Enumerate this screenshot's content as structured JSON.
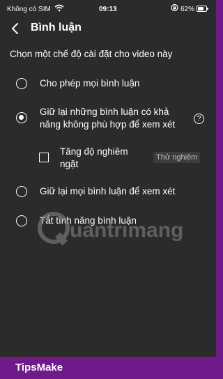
{
  "status_bar": {
    "carrier": "Không có SIM",
    "time": "09:13",
    "battery": "62%",
    "battery_level": 0.62
  },
  "header": {
    "title": "Bình luận"
  },
  "prompt": "Chọn một chế độ cài đặt cho video này",
  "options": [
    {
      "label": "Cho phép mọi bình luận",
      "selected": false
    },
    {
      "label_line1": "Giữ lại những bình luận có khả",
      "label_line2": "năng không phù hợp để xem xét",
      "selected": true,
      "help_icon": "?"
    },
    {
      "label": "Giữ lại mọi bình luận để xem xét",
      "selected": false
    },
    {
      "label": "Tắt tính năng bình luận",
      "selected": false
    }
  ],
  "sub_option": {
    "label_line1": "Tăng độ nghiêm",
    "label_line2": "ngặt",
    "badge": "Thử nghiệm",
    "checked": false
  },
  "watermark": {
    "text": "uantrimang",
    "letter": "Q"
  },
  "brand": "TipsMake"
}
